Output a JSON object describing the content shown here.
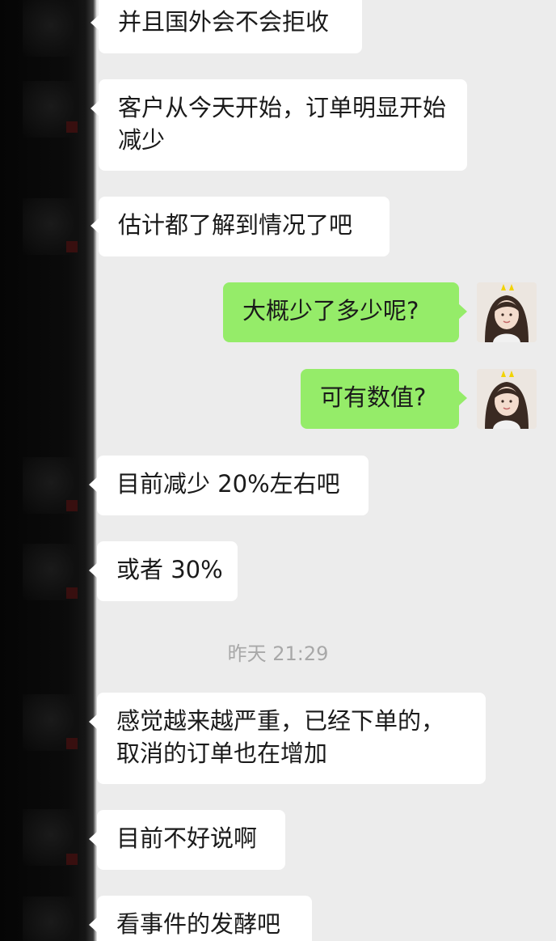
{
  "messages": [
    {
      "side": "incoming",
      "text": "并且国外会不会拒收"
    },
    {
      "side": "incoming",
      "text": "客户从今天开始，订单明显开始减少"
    },
    {
      "side": "incoming",
      "text": "估计都了解到情况了吧"
    },
    {
      "side": "outgoing",
      "text": "大概少了多少呢?"
    },
    {
      "side": "outgoing",
      "text": "可有数值?"
    },
    {
      "side": "incoming",
      "text": "目前减少 20%左右吧"
    },
    {
      "side": "incoming",
      "text": "或者 30%"
    },
    {
      "side": "incoming",
      "text": "感觉越来越严重，已经下单的，取消的订单也在增加"
    },
    {
      "side": "incoming",
      "text": "目前不好说啊"
    },
    {
      "side": "incoming",
      "text": "看事件的发酵吧"
    }
  ],
  "timestamp": "昨天 21:29",
  "colors": {
    "background": "#ececec",
    "incoming_bubble": "#ffffff",
    "outgoing_bubble": "#95ec69",
    "timestamp_text": "#a8a8a8"
  },
  "icons": {
    "self_avatar": "user-avatar-icon"
  }
}
